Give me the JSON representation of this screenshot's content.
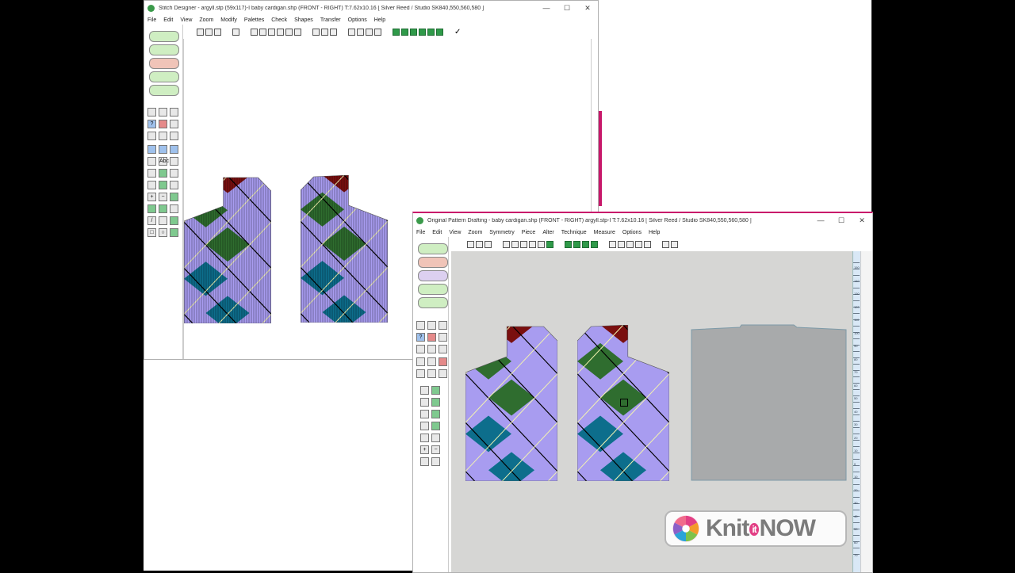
{
  "stitch_designer": {
    "title": "Stitch Designer - argyll.stp (59x117)-I      baby cardigan.shp (FRONT - RIGHT)    T:7.62x10.16    [ Silver Reed / Studio SK840,550,560,580 ]",
    "menu": [
      "File",
      "Edit",
      "View",
      "Zoom",
      "Modify",
      "Palettes",
      "Check",
      "Shapes",
      "Transfer",
      "Options",
      "Help"
    ],
    "tool_glyphs": [
      "Abc"
    ],
    "pieces": [
      {
        "cols": 29,
        "rows": 52,
        "neck_side": "right"
      },
      {
        "cols": 29,
        "rows": 52,
        "neck_side": "left"
      }
    ]
  },
  "pattern_drafting": {
    "title": "Original Pattern Drafting - baby cardigan.shp (FRONT - RIGHT)  argyll.stp-I    T:7.62x10.16    [ Silver Reed / Studio SK840,550,560,580 ]",
    "menu": [
      "File",
      "Edit",
      "View",
      "Zoom",
      "Symmetry",
      "Piece",
      "Alter",
      "Technique",
      "Measure",
      "Options",
      "Help"
    ],
    "ruler_labels": [
      "150",
      "140",
      "130",
      "120",
      "110",
      "100",
      "90",
      "80",
      "70",
      "60",
      "50",
      "40",
      "30",
      "20",
      "10",
      "0",
      "10",
      "20",
      "30",
      "40",
      "50",
      "60",
      "70"
    ],
    "pieces": [
      {
        "cols": 30,
        "rows": 50,
        "neck_side": "right"
      },
      {
        "cols": 30,
        "rows": 50,
        "neck_side": "left"
      }
    ]
  },
  "watermark": {
    "part1": "Knit",
    "part2": "it",
    "part3": "NOW"
  },
  "colors": {
    "purple": "#a89cf0",
    "green": "#2f6d2f",
    "teal": "#0d6e8c",
    "maroon": "#7a0f0f",
    "line_black": "#000000",
    "line_yellow": "#f3f3b0",
    "back_piece": "#a8aaab",
    "workspace": "#d6d6d4",
    "accent_pink": "#c8186a"
  }
}
